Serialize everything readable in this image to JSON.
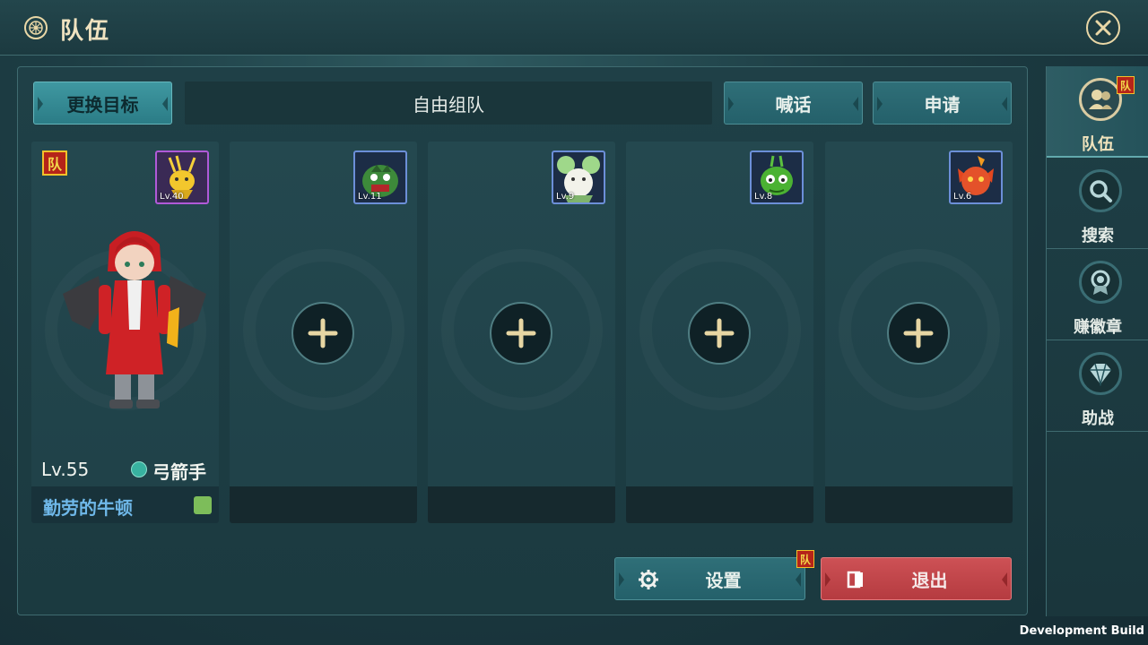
{
  "header": {
    "title": "队伍"
  },
  "toolbar": {
    "change_target": "更换目标",
    "free_team": "自由组队",
    "shout": "喊话",
    "apply": "申请"
  },
  "leader": {
    "team_badge": "队",
    "pet_level": "Lv.40",
    "level": "Lv.55",
    "class": "弓箭手",
    "name": "勤劳的牛顿"
  },
  "slots": [
    {
      "pet_level": "Lv.11",
      "add_symbol": "+"
    },
    {
      "pet_level": "Lv.9",
      "add_symbol": "+"
    },
    {
      "pet_level": "Lv.8",
      "add_symbol": "+"
    },
    {
      "pet_level": "Lv.6",
      "add_symbol": "+"
    }
  ],
  "footer": {
    "settings": "设置",
    "settings_badge": "队",
    "exit": "退出"
  },
  "sidebar": {
    "badge": "队",
    "items": [
      {
        "label": "队伍",
        "icon": "team-icon",
        "active": true
      },
      {
        "label": "搜索",
        "icon": "search-icon",
        "active": false
      },
      {
        "label": "赚徽章",
        "icon": "medal-icon",
        "active": false
      },
      {
        "label": "助战",
        "icon": "diamond-icon",
        "active": false
      }
    ]
  },
  "watermark": "Development Build",
  "colors": {
    "accent_teal": "#3f98a1",
    "exit_red": "#c5474a",
    "gold": "#e9d7a6",
    "name_blue": "#6fb8e9"
  }
}
